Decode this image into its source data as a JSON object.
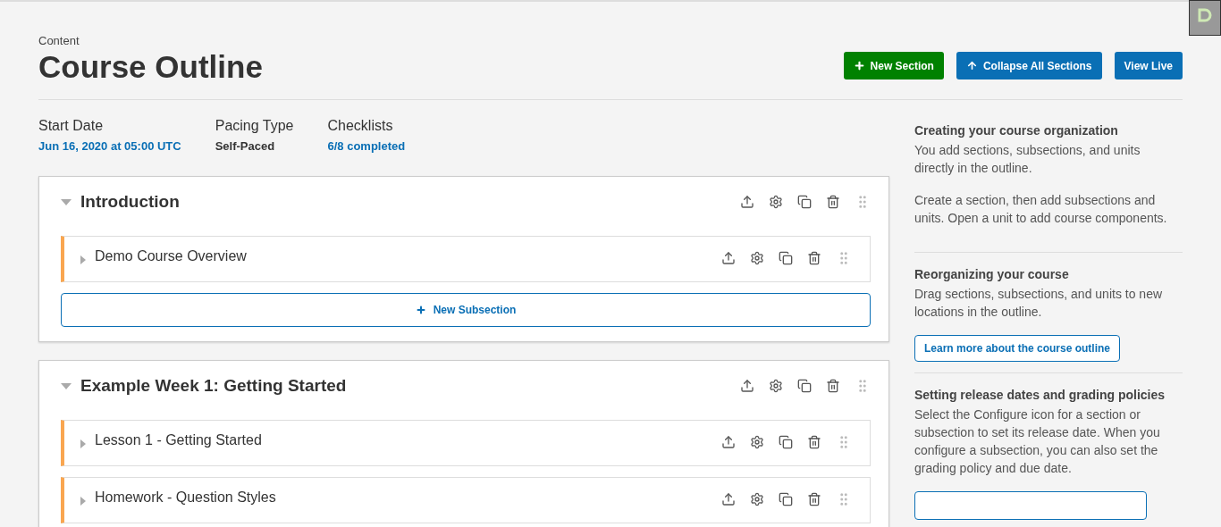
{
  "header": {
    "breadcrumb": "Content",
    "title": "Course Outline",
    "actions": [
      {
        "label": "New Section",
        "kind": "add"
      },
      {
        "label": "Collapse All Sections",
        "kind": "collapse"
      },
      {
        "label": "View Live",
        "kind": "plain"
      }
    ]
  },
  "stats": [
    {
      "label": "Start Date",
      "value": "Jun 16, 2020 at 05:00 UTC",
      "kind": "link"
    },
    {
      "label": "Pacing Type",
      "value": "Self-Paced",
      "kind": "text"
    },
    {
      "label": "Checklists",
      "value": "6/8 completed",
      "kind": "link"
    }
  ],
  "sections": [
    {
      "title": "Introduction",
      "expanded": true,
      "subsections": [
        {
          "title": "Demo Course Overview",
          "expanded": false
        }
      ],
      "add_label": "New Subsection"
    },
    {
      "title": "Example Week 1: Getting Started",
      "expanded": true,
      "subsections": [
        {
          "title": "Lesson 1 - Getting Started",
          "expanded": false
        },
        {
          "title": "Homework - Question Styles",
          "expanded": false
        }
      ]
    }
  ],
  "sidebar": [
    {
      "heading": "Creating your course organization",
      "paragraphs": [
        "You add sections, subsections, and units directly in the outline.",
        "Create a section, then add subsections and units. Open a unit to add course components."
      ]
    },
    {
      "heading": "Reorganizing your course",
      "paragraphs": [
        "Drag sections, subsections, and units to new locations in the outline."
      ],
      "button": "Learn more about the course outline"
    },
    {
      "heading": "Setting release dates and grading policies",
      "paragraphs": [
        "Select the Configure icon for a section or subsection to set its release date. When you configure a subsection, you can also set the grading policy and due date."
      ],
      "cut_button": true
    }
  ]
}
